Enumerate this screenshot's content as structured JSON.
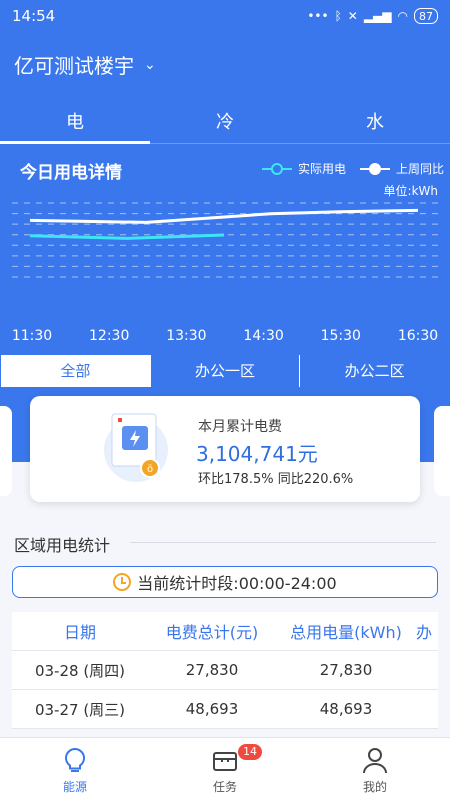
{
  "status": {
    "time": "14:54",
    "battery": "87"
  },
  "header": {
    "building": "亿可测试楼宇"
  },
  "tabs": [
    {
      "label": "电"
    },
    {
      "label": "冷"
    },
    {
      "label": "水"
    }
  ],
  "chart_section": {
    "title": "今日用电详情",
    "legend_actual": "实际用电",
    "legend_lastweek": "上周同比",
    "unit": "单位:kWh"
  },
  "chart_data": {
    "type": "line",
    "x_ticks": [
      "11:30",
      "12:30",
      "13:30",
      "14:30",
      "15:30",
      "16:30"
    ],
    "series": [
      {
        "name": "实际用电",
        "color": "#3ee6f5",
        "points": [
          [
            0,
            0.62
          ],
          [
            0.25,
            0.58
          ],
          [
            0.5,
            0.63
          ]
        ]
      },
      {
        "name": "上周同比",
        "color": "#ffffff",
        "points": [
          [
            0,
            0.85
          ],
          [
            0.3,
            0.82
          ],
          [
            0.45,
            0.88
          ],
          [
            0.62,
            0.95
          ],
          [
            0.8,
            0.98
          ],
          [
            1,
            1.0
          ]
        ]
      }
    ],
    "gridlines": 8
  },
  "segments": [
    {
      "label": "全部"
    },
    {
      "label": "办公一区"
    },
    {
      "label": "办公二区"
    }
  ],
  "cost_card": {
    "label": "本月累计电费",
    "value": "3,104,741元",
    "sub": "环比178.5% 同比220.6%"
  },
  "region": {
    "title": "区域用电统计",
    "period": "当前统计时段:00:00-24:00"
  },
  "table": {
    "headers": [
      "日期",
      "电费总计(元)",
      "总用电量(kWh)",
      "办"
    ],
    "rows": [
      [
        "03-28 (周四)",
        "27,830",
        "27,830"
      ],
      [
        "03-27 (周三)",
        "48,693",
        "48,693"
      ]
    ]
  },
  "nav": [
    {
      "label": "能源"
    },
    {
      "label": "任务",
      "badge": "14"
    },
    {
      "label": "我的"
    }
  ]
}
